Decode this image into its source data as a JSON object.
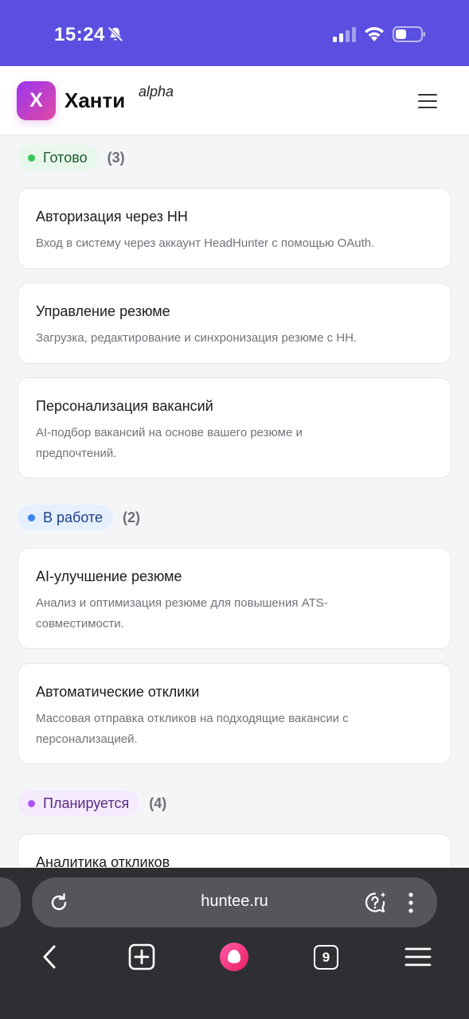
{
  "status_bar": {
    "time": "15:24",
    "mute_icon": "bell-slash-icon",
    "signal_icon": "cellular-signal-icon",
    "wifi_icon": "wifi-icon",
    "battery_icon": "battery-icon"
  },
  "header": {
    "logo_letter": "Х",
    "brand_name": "Ханти",
    "brand_tag": "alpha",
    "menu_icon": "hamburger-menu-icon"
  },
  "sections": [
    {
      "label": "Готово",
      "count": "(3)",
      "dot_color": "#34c759",
      "pill_bg": "#e8f7ec",
      "pill_text": "#1d5c2f",
      "cards": [
        {
          "title": "Авторизация через HH",
          "description": "Вход в систему через аккаунт HeadHunter с помощью OAuth."
        },
        {
          "title": "Управление резюме",
          "description": "Загрузка, редактирование и синхронизация резюме с HH."
        },
        {
          "title": "Персонализация вакансий",
          "description_lines": [
            "AI-подбор вакансий на основе вашего резюме и",
            "предпочтений."
          ]
        }
      ]
    },
    {
      "label": "В работе",
      "count": "(2)",
      "dot_color": "#3b82f6",
      "pill_bg": "#e5effd",
      "pill_text": "#1e3f8a",
      "cards": [
        {
          "title": "AI-улучшение резюме",
          "description_lines": [
            "Анализ и оптимизация резюме для повышения ATS-",
            "совместимости."
          ]
        },
        {
          "title": "Автоматические отклики",
          "description_lines": [
            "Массовая отправка откликов на подходящие вакансии с",
            "персонализацией."
          ]
        }
      ]
    },
    {
      "label": "Планируется",
      "count": "(4)",
      "dot_color": "#a855f7",
      "pill_bg": "#f5ebfd",
      "pill_text": "#5b2a86",
      "cards": [
        {
          "title": "Аналитика откликов"
        }
      ]
    }
  ],
  "browser": {
    "url": "huntee.ru",
    "tabs_count": "9",
    "icons": [
      "reload-icon",
      "assistant-icon",
      "more-vertical-icon",
      "back-icon",
      "new-tab-icon",
      "alice-icon",
      "menu-icon"
    ]
  }
}
